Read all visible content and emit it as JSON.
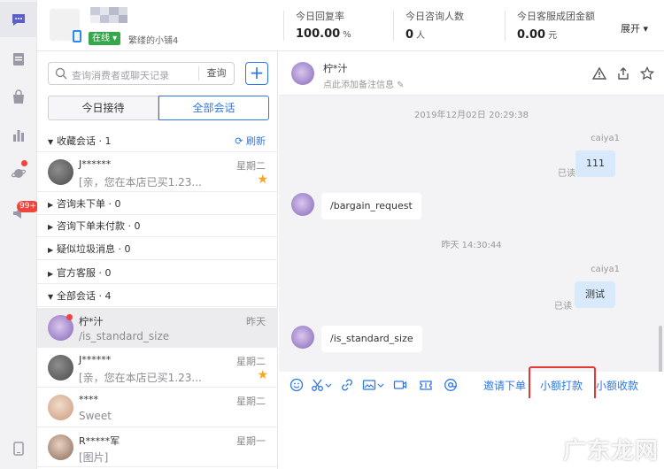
{
  "header": {
    "online_label": "在线 ▾",
    "shop_name": "繁缕的小铺4",
    "stats": [
      {
        "label": "今日回复率",
        "value": "100.00",
        "unit": "%"
      },
      {
        "label": "今日咨询人数",
        "value": "0",
        "unit": "人"
      },
      {
        "label": "今日客服成团金额",
        "value": "0.00",
        "unit": "元"
      }
    ],
    "expand_label": "展开 ▾",
    "mosaic_colors": [
      "#c9ccd8",
      "#e3e4ec",
      "#b8bccb",
      "#d8dae2",
      "#eceef3",
      "#c2c6d4",
      "#dadde6",
      "#b0b4c4"
    ]
  },
  "rail": {
    "icons": [
      "chat-icon",
      "document-icon",
      "bag-icon",
      "bar-chart-icon",
      "planet-icon",
      "megaphone-icon",
      "tablet-icon"
    ],
    "badge": "99+",
    "accent": "#5b5fc7"
  },
  "sidebar": {
    "search_placeholder": "查询消费者或聊天记录",
    "search_button": "查询",
    "add_button": "+",
    "tabs": [
      "今日接待",
      "全部会话"
    ],
    "groups": {
      "favorites": "收藏会话 · 1",
      "refresh": "刷新",
      "not_ordered": "咨询未下单 · 0",
      "unpaid": "咨询下单未付款 · 0",
      "spam": "疑似垃圾消息 · 0",
      "official": "官方客服 · 0",
      "all": "全部会话 · 4"
    },
    "favorite_conv": {
      "name": "J******",
      "time": "星期二",
      "msg": "[亲，您在本店已买1.23..."
    },
    "conversations": [
      {
        "name": "柠*汁",
        "time": "昨天",
        "msg": "/is_standard_size"
      },
      {
        "name": "J******",
        "time": "星期二",
        "msg": "[亲，您在本店已买1.23..."
      },
      {
        "name": "****",
        "time": "星期二",
        "msg": "Sweet"
      },
      {
        "name": "R*****军",
        "time": "星期一",
        "msg": "[图片]"
      }
    ]
  },
  "chat": {
    "name": "柠*汁",
    "remark_placeholder": "点此添加备注信息",
    "messages": {
      "ts1": "2019年12月02日 20:29:38",
      "sender1": "caiya1",
      "text1": "111",
      "read1": "已读",
      "text2": "/bargain_request",
      "ts2": "昨天 14:30:44",
      "sender2": "caiya1",
      "text3": "测试",
      "read2": "已读",
      "text4": "/is_standard_size"
    },
    "toolbar_links": {
      "invite_order": "邀请下单",
      "small_pay": "小额打款",
      "small_collect": "小额收款"
    }
  },
  "watermark": "广东龙网"
}
